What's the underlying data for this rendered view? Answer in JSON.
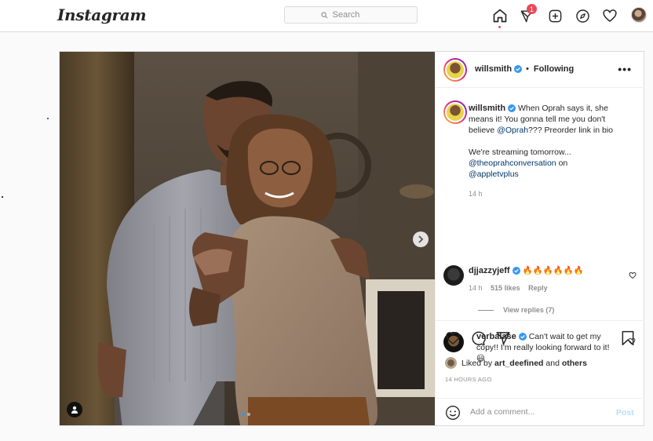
{
  "nav": {
    "logo": "Instagram",
    "search_placeholder": "Search",
    "notification_count": "1",
    "icons": [
      "home-icon",
      "direct-icon",
      "new-post-icon",
      "explore-icon",
      "activity-icon"
    ]
  },
  "post": {
    "username": "willsmith",
    "following_label": "Following",
    "more_label": "•••",
    "caption_part1": "When Oprah says it, she means it! You gonna tell me you don't believe ",
    "caption_mention1": "@Oprah",
    "caption_part2": "??? Preorder link in bio",
    "caption_line2_a": "We're streaming tomorrow...",
    "caption_mention2": "@theoprahconversation",
    "caption_on": " on",
    "caption_mention3": "@appletvplus",
    "caption_time": "14 h",
    "comments": [
      {
        "username": "djjazzyjeff",
        "text": "🔥🔥🔥🔥🔥🔥",
        "time": "14 h",
        "likes": "515 likes",
        "reply": "Reply",
        "view_replies": "View replies (7)"
      },
      {
        "username": "verbalase",
        "text": "Can't wait to get my copy!! I'm really looking forward to it! 😃"
      }
    ],
    "liked_by_prefix": "Liked by ",
    "liked_by_user": "art_deefined",
    "liked_by_suffix": " and ",
    "liked_by_others": "others",
    "timestamp": "14 HOURS AGO",
    "add_comment_placeholder": "Add a comment...",
    "post_button": "Post"
  },
  "colors": {
    "accent": "#0095f6",
    "notification": "#ed4956",
    "link": "#00376b",
    "post_disabled": "#b2dffc"
  }
}
